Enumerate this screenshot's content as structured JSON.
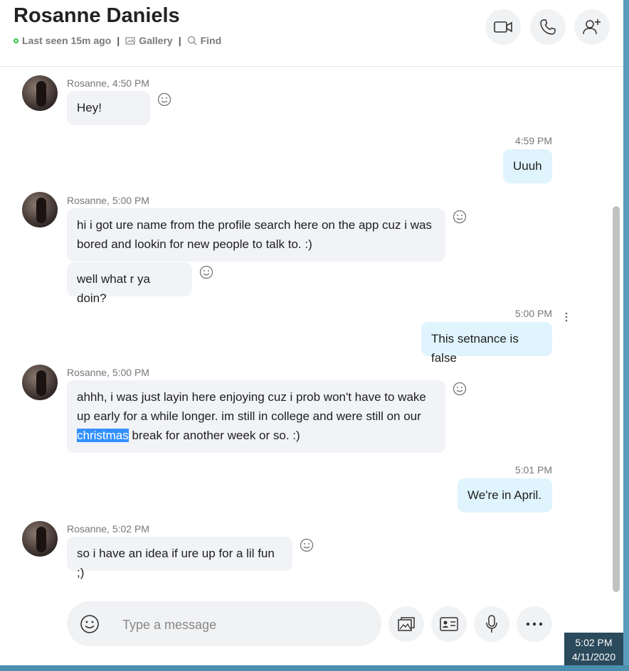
{
  "header": {
    "contact_name": "Rosanne Daniels",
    "last_seen": "Last seen 15m ago",
    "separator": "|",
    "gallery_label": "Gallery",
    "find_label": "Find"
  },
  "messages": [
    {
      "from": "them",
      "sender_time": "Rosanne, 4:50 PM",
      "lines": [
        "Hey!"
      ]
    },
    {
      "from": "me",
      "time": "4:59 PM",
      "text": "Uuuh"
    },
    {
      "from": "them",
      "sender_time": "Rosanne, 5:00 PM",
      "text1": "hi i got ure name from the profile search here on the app cuz i was bored and lookin for new people to talk to. :)",
      "text2": "well what r ya doin?"
    },
    {
      "from": "me",
      "time": "5:00 PM",
      "text": "This setnance is false"
    },
    {
      "from": "them",
      "sender_time": "Rosanne, 5:00 PM",
      "text_before": "ahhh, i was just layin here enjoying cuz i prob won't have to wake up early for a while longer. im still in college and were still on our ",
      "text_highlight": "christmas",
      "text_after": " break for another week or so. :)"
    },
    {
      "from": "me",
      "time": "5:01 PM",
      "text": "We're in April."
    },
    {
      "from": "them",
      "sender_time": "Rosanne, 5:02 PM",
      "text": "so i have an idea if ure up for a lil fun ;)"
    }
  ],
  "composer": {
    "placeholder": "Type a message"
  },
  "clock": {
    "time": "5:02 PM",
    "date": "4/11/2020"
  },
  "colors": {
    "bubble_them": "#f1f3f6",
    "bubble_me": "#dff4fd",
    "online": "#2ec946",
    "selection": "#3390ff"
  }
}
